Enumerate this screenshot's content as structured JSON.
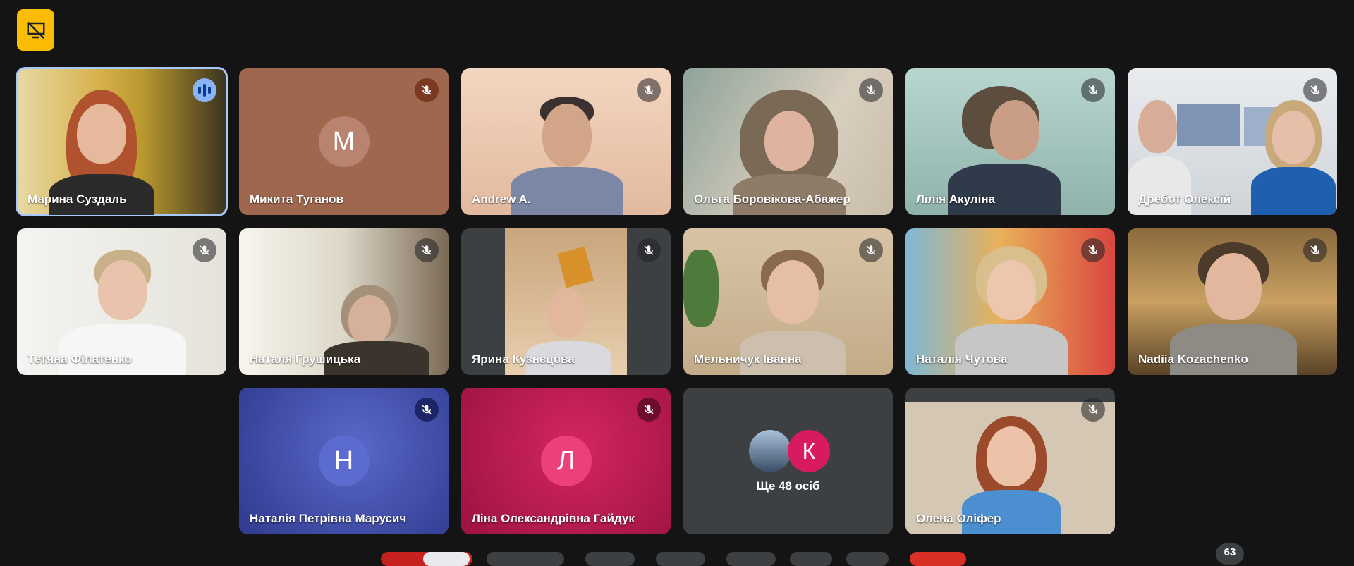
{
  "toolbar": {
    "top_button_icon": "no-screen-share-icon"
  },
  "participants": [
    {
      "name": "Марина Суздаль",
      "speaking": true
    },
    {
      "name": "Микита Туганов",
      "initial": "М",
      "muted": true,
      "avatar_color": "#a0674f"
    },
    {
      "name": "Andrew A.",
      "muted": true
    },
    {
      "name": "Ольга Боровікова-Абажер",
      "muted": true
    },
    {
      "name": "Лілія Акуліна",
      "muted": true
    },
    {
      "name": "Дребот Олексій",
      "muted": true
    },
    {
      "name": "Тетяна Філатенко",
      "muted": true
    },
    {
      "name": "Наталя Грушицька",
      "muted": true
    },
    {
      "name": "Ярина Кузнєцова",
      "muted": true
    },
    {
      "name": "Мельничук Іванна",
      "muted": true
    },
    {
      "name": "Наталія Чутова",
      "muted": true
    },
    {
      "name": "Nadiia Kozachenko",
      "muted": true
    },
    {
      "name": "Наталія Петрівна Марусич",
      "initial": "Н",
      "muted": true,
      "avatar_color": "#4b5cc4"
    },
    {
      "name": "Ліна Олександрівна Гайдук",
      "initial": "Л",
      "muted": true,
      "avatar_color": "#e91e63"
    },
    {
      "name": "Олена Оліфер",
      "muted": true
    }
  ],
  "more_tile": {
    "label": "Ще 48 осіб",
    "avatar_initial": "К"
  },
  "participant_count": "63",
  "colors": {
    "accent": "#fbbc04",
    "active_outline": "#a8c7fa",
    "tile_bg": "#3c4043"
  }
}
